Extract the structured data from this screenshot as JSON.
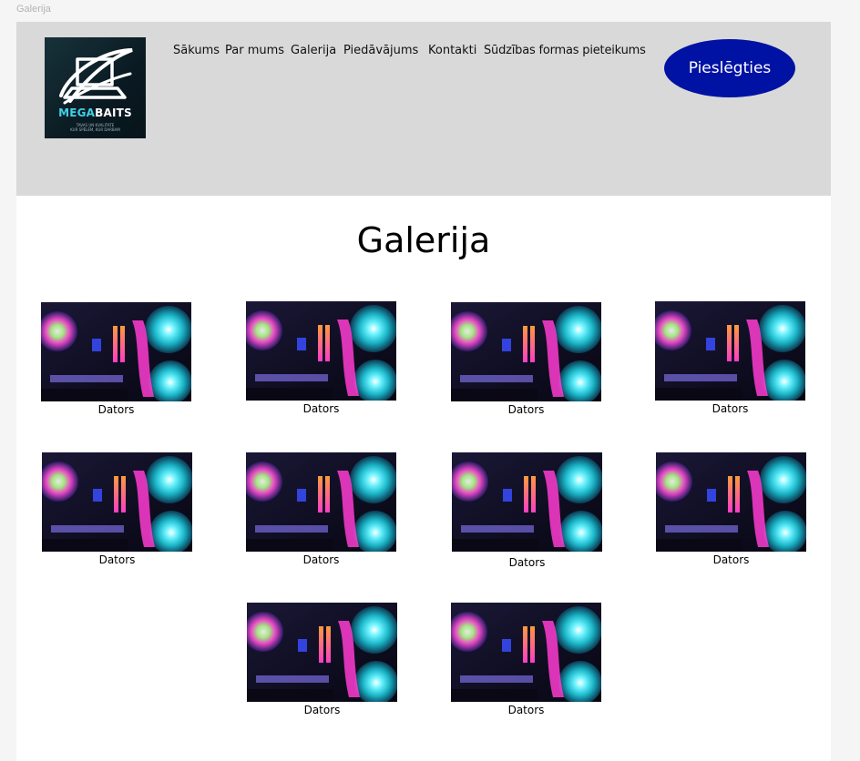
{
  "frame_label": "Galerija",
  "logo": {
    "brand_part1": "MEGA",
    "brand_part2": "BAITS",
    "tagline": "TAVAS UN KVALITATE\nKUR SPĒLĒM, KUR DARBAM",
    "icon": "laptop-swoosh-icon"
  },
  "nav": {
    "items": [
      {
        "label": "Sākums"
      },
      {
        "label": "Par mums"
      },
      {
        "label": "Galerija"
      },
      {
        "label": "Piedāvājums"
      },
      {
        "label": "Kontakti"
      },
      {
        "label": "Sūdzības formas pieteikums"
      }
    ]
  },
  "login": {
    "label": "Pieslēgties"
  },
  "title": "Galerija",
  "gallery": {
    "items": [
      {
        "caption": "Dators"
      },
      {
        "caption": "Dators"
      },
      {
        "caption": "Dators"
      },
      {
        "caption": "Dators"
      },
      {
        "caption": "Dators"
      },
      {
        "caption": "Dators"
      },
      {
        "caption": "Dators"
      },
      {
        "caption": "Dators"
      },
      {
        "caption": "Dators"
      },
      {
        "caption": "Dators"
      }
    ]
  },
  "colors": {
    "header_bg": "#d9d9d9",
    "button_bg": "#0012a3",
    "button_text": "#ffffff",
    "logo_accent": "#3fd0e8"
  }
}
